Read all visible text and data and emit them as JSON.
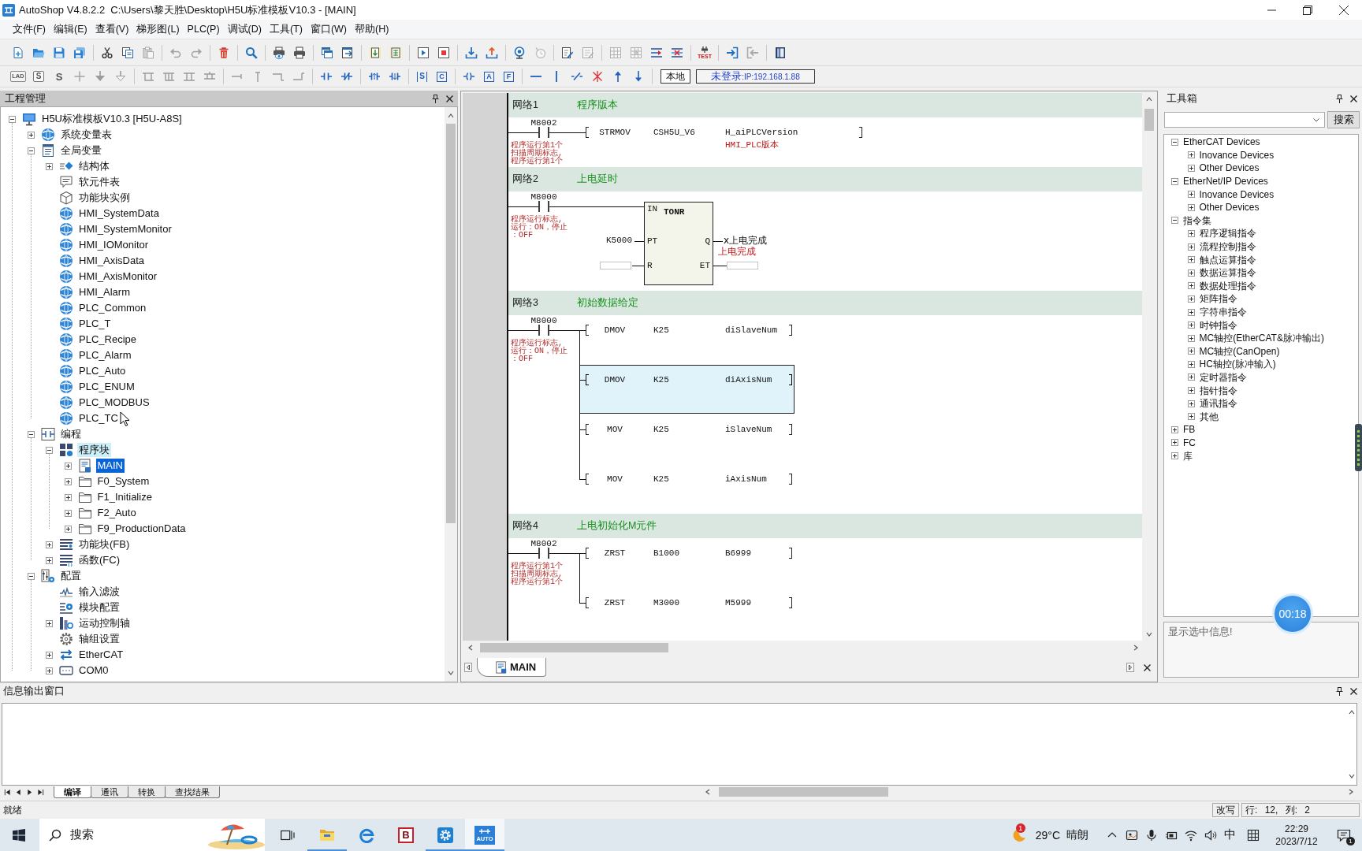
{
  "window": {
    "title": "AutoShop V4.8.2.2  C:\\Users\\黎天胜\\Desktop\\H5U标准模板V10.3 - [MAIN]"
  },
  "menu": [
    "文件(F)",
    "编辑(E)",
    "查看(V)",
    "梯形图(L)",
    "PLC(P)",
    "调试(D)",
    "工具(T)",
    "窗口(W)",
    "帮助(H)"
  ],
  "toolbar_1": [
    [
      {
        "kind": "new",
        "disabled": false
      },
      {
        "kind": "open",
        "disabled": false
      },
      {
        "kind": "save",
        "disabled": false
      },
      {
        "kind": "saveall",
        "disabled": false
      }
    ],
    [
      {
        "kind": "cut",
        "disabled": false
      },
      {
        "kind": "copy",
        "disabled": false
      },
      {
        "kind": "paste",
        "disabled": true
      }
    ],
    [
      {
        "kind": "undo",
        "disabled": true
      },
      {
        "kind": "redo",
        "disabled": true
      }
    ],
    [
      {
        "kind": "delete",
        "disabled": false
      }
    ],
    [
      {
        "kind": "find",
        "disabled": false
      }
    ],
    [
      {
        "kind": "preview",
        "disabled": false
      },
      {
        "kind": "print",
        "disabled": false
      }
    ],
    [
      {
        "kind": "windows",
        "disabled": false
      },
      {
        "kind": "windowarrow",
        "disabled": false
      }
    ],
    [
      {
        "kind": "docdown",
        "disabled": false
      },
      {
        "kind": "docgrid",
        "disabled": false
      }
    ],
    [
      {
        "kind": "run",
        "disabled": false
      },
      {
        "kind": "stop",
        "disabled": false
      }
    ],
    [
      {
        "kind": "download",
        "disabled": false
      },
      {
        "kind": "upload",
        "disabled": false
      }
    ],
    [
      {
        "kind": "monitor",
        "disabled": false
      },
      {
        "kind": "timer",
        "disabled": true
      }
    ],
    [
      {
        "kind": "editcheck",
        "disabled": false
      },
      {
        "kind": "edit",
        "disabled": true
      }
    ],
    [
      {
        "kind": "grid",
        "disabled": true
      },
      {
        "kind": "gridstar",
        "disabled": true
      },
      {
        "kind": "rowins",
        "disabled": false
      },
      {
        "kind": "rowdel",
        "disabled": false
      }
    ],
    [
      {
        "kind": "test",
        "label": "TEST",
        "disabled": false
      }
    ],
    [
      {
        "kind": "login",
        "disabled": false
      },
      {
        "kind": "logout",
        "disabled": true
      }
    ],
    [
      {
        "kind": "book",
        "disabled": false
      }
    ]
  ],
  "toolbar_2": [
    [
      {
        "kind": "lad",
        "label": "LAD",
        "disabled": true
      },
      {
        "kind": "sbox",
        "label": "S",
        "disabled": true
      },
      {
        "kind": "sdollar",
        "label": "S",
        "disabled": true
      },
      {
        "kind": "cross",
        "disabled": true
      },
      {
        "kind": "arrowfill",
        "disabled": true
      },
      {
        "kind": "arrowopen",
        "disabled": true
      }
    ],
    [
      {
        "kind": "branch1",
        "disabled": true
      },
      {
        "kind": "branch2",
        "disabled": true
      },
      {
        "kind": "branch3",
        "disabled": true
      },
      {
        "kind": "branch4",
        "disabled": true
      }
    ],
    [
      {
        "kind": "lineright",
        "disabled": true
      },
      {
        "kind": "lineup",
        "disabled": true
      },
      {
        "kind": "cornerdown",
        "disabled": true
      },
      {
        "kind": "cornerup",
        "disabled": true
      }
    ],
    [
      {
        "kind": "contact",
        "disabled": false
      },
      {
        "kind": "ncontact",
        "disabled": false
      }
    ],
    [
      {
        "kind": "rising",
        "disabled": false
      },
      {
        "kind": "falling",
        "disabled": false
      }
    ],
    [
      {
        "kind": "scontact",
        "label": "S",
        "disabled": false
      },
      {
        "kind": "cblock",
        "label": "C",
        "disabled": false
      }
    ],
    [
      {
        "kind": "coil",
        "disabled": false
      },
      {
        "kind": "ablock",
        "label": "A",
        "disabled": false
      },
      {
        "kind": "fblock",
        "label": "F",
        "disabled": false
      }
    ],
    [
      {
        "kind": "hline",
        "disabled": false
      },
      {
        "kind": "vline",
        "disabled": false
      },
      {
        "kind": "slash",
        "disabled": false
      },
      {
        "kind": "xdel",
        "disabled": false
      },
      {
        "kind": "up",
        "disabled": false
      },
      {
        "kind": "down",
        "disabled": false
      }
    ]
  ],
  "connection": {
    "mode": "本地",
    "status": "未登录",
    "address": ":IP:192.168.1.88"
  },
  "project_tree": {
    "title": "工程管理",
    "items": [
      {
        "label": "H5U标准模板V10.3 [H5U-A8S]",
        "kind": "computer",
        "expanded": true,
        "selected": false,
        "highlighted": false,
        "children": [
          {
            "label": "系统变量表",
            "kind": "globe",
            "expanded": false,
            "selected": false,
            "highlighted": false
          },
          {
            "label": "全局变量",
            "kind": "varlist",
            "expanded": true,
            "selected": false,
            "highlighted": false,
            "children": [
              {
                "label": "结构体",
                "kind": "struct",
                "expanded": false,
                "selected": false,
                "highlighted": false
              },
              {
                "label": "软元件表",
                "kind": "table",
                "selected": false,
                "highlighted": false
              },
              {
                "label": "功能块实例",
                "kind": "cube",
                "selected": false,
                "highlighted": false
              },
              {
                "label": "HMI_SystemData",
                "kind": "globe",
                "selected": false,
                "highlighted": false
              },
              {
                "label": "HMI_SystemMonitor",
                "kind": "globe",
                "selected": false,
                "highlighted": false
              },
              {
                "label": "HMI_IOMonitor",
                "kind": "globe",
                "selected": false,
                "highlighted": false
              },
              {
                "label": "HMI_AxisData",
                "kind": "globe",
                "selected": false,
                "highlighted": false
              },
              {
                "label": "HMI_AxisMonitor",
                "kind": "globe",
                "selected": false,
                "highlighted": false
              },
              {
                "label": "HMI_Alarm",
                "kind": "globe",
                "selected": false,
                "highlighted": false
              },
              {
                "label": "PLC_Common",
                "kind": "globe",
                "selected": false,
                "highlighted": false
              },
              {
                "label": "PLC_T",
                "kind": "globe",
                "selected": false,
                "highlighted": false
              },
              {
                "label": "PLC_Recipe",
                "kind": "globe",
                "selected": false,
                "highlighted": false
              },
              {
                "label": "PLC_Alarm",
                "kind": "globe",
                "selected": false,
                "highlighted": false
              },
              {
                "label": "PLC_Auto",
                "kind": "globe",
                "selected": false,
                "highlighted": false
              },
              {
                "label": "PLC_ENUM",
                "kind": "globe",
                "selected": false,
                "highlighted": false
              },
              {
                "label": "PLC_MODBUS",
                "kind": "globe",
                "selected": false,
                "highlighted": false
              },
              {
                "label": "PLC_TC",
                "kind": "globe",
                "selected": false,
                "highlighted": false
              }
            ]
          },
          {
            "label": "编程",
            "kind": "ladder",
            "expanded": true,
            "selected": false,
            "highlighted": false,
            "children": [
              {
                "label": "程序块",
                "kind": "blocks",
                "expanded": true,
                "selected": false,
                "highlighted": true,
                "children": [
                  {
                    "label": "MAIN",
                    "kind": "program",
                    "expanded": false,
                    "selected": true,
                    "highlighted": false
                  },
                  {
                    "label": "F0_System",
                    "kind": "folder",
                    "expanded": false,
                    "selected": false,
                    "highlighted": false
                  },
                  {
                    "label": "F1_Initialize",
                    "kind": "folder",
                    "expanded": false,
                    "selected": false,
                    "highlighted": false
                  },
                  {
                    "label": "F2_Auto",
                    "kind": "folder",
                    "expanded": false,
                    "selected": false,
                    "highlighted": false
                  },
                  {
                    "label": "F9_ProductionData",
                    "kind": "folder",
                    "expanded": false,
                    "selected": false,
                    "highlighted": false
                  }
                ]
              },
              {
                "label": "功能块(FB)",
                "kind": "fblist",
                "expanded": false,
                "selected": false,
                "highlighted": false
              },
              {
                "label": "函数(FC)",
                "kind": "fclist",
                "expanded": false,
                "selected": false,
                "highlighted": false
              }
            ]
          },
          {
            "label": "配置",
            "kind": "config",
            "expanded": true,
            "selected": false,
            "highlighted": false,
            "children": [
              {
                "label": "输入滤波",
                "kind": "filter",
                "selected": false,
                "highlighted": false
              },
              {
                "label": "模块配置",
                "kind": "module",
                "selected": false,
                "highlighted": false
              },
              {
                "label": "运动控制轴",
                "kind": "axis",
                "expanded": false,
                "selected": false,
                "highlighted": false
              },
              {
                "label": "轴组设置",
                "kind": "gear",
                "selected": false,
                "highlighted": false
              },
              {
                "label": "EtherCAT",
                "kind": "ethercat",
                "expanded": false,
                "selected": false,
                "highlighted": false
              },
              {
                "label": "COM0",
                "kind": "com",
                "expanded": false,
                "selected": false,
                "highlighted": false
              }
            ]
          }
        ]
      }
    ]
  },
  "editor": {
    "networks": [
      {
        "label": "网络1",
        "comment": "程序版本",
        "contact": {
          "address": "M8002",
          "comment": "程序运行第1个扫描周期标志,程序运行第1个"
        },
        "instructions": [
          {
            "op": "STRMOV",
            "operands": [
              "CSH5U_V6",
              "H_aiPLCVersion"
            ],
            "note": "HMI_PLC版本",
            "selected": false
          }
        ]
      },
      {
        "label": "网络2",
        "comment": "上电延时",
        "contact": {
          "address": "M8000",
          "comment": "程序运行标志,运行：ON，停止：OFF"
        },
        "block": {
          "name": "TONR",
          "inputs": [
            {
              "pin": "IN",
              "kind": "wire"
            },
            {
              "pin": "PT",
              "kind": "value",
              "value": "K5000"
            },
            {
              "pin": "R",
              "kind": "field"
            }
          ],
          "outputs": [
            {
              "pin": "Q",
              "kind": "value",
              "value": "x上电完成",
              "note": "上电完成"
            },
            {
              "pin": "ET",
              "kind": "field"
            }
          ]
        }
      },
      {
        "label": "网络3",
        "comment": "初始数据给定",
        "contact": {
          "address": "M8000",
          "comment": "程序运行标志,运行：ON，停止：OFF"
        },
        "instructions": [
          {
            "op": "DMOV",
            "operands": [
              "K25",
              "diSlaveNum"
            ],
            "selected": false
          },
          {
            "op": "DMOV",
            "operands": [
              "K25",
              "diAxisNum"
            ],
            "selected": true
          },
          {
            "op": "MOV",
            "operands": [
              "K25",
              "iSlaveNum"
            ],
            "selected": false
          },
          {
            "op": "MOV",
            "operands": [
              "K25",
              "iAxisNum"
            ],
            "selected": false
          }
        ]
      },
      {
        "label": "网络4",
        "comment": "上电初始化M元件",
        "contact": {
          "address": "M8002",
          "comment": "程序运行第1个扫描周期标志,程序运行第1个"
        },
        "instructions": [
          {
            "op": "ZRST",
            "operands": [
              "B1000",
              "B6999"
            ],
            "selected": false
          },
          {
            "op": "ZRST",
            "operands": [
              "M3000",
              "M5999"
            ],
            "selected": false
          }
        ]
      }
    ],
    "tabs": [
      {
        "label": "MAIN",
        "selected": true
      }
    ]
  },
  "toolbox": {
    "title": "工具箱",
    "search_button": "搜索",
    "items": [
      {
        "label": "EtherCAT Devices",
        "expanded": true,
        "selected": false,
        "children": [
          {
            "label": "Inovance Devices",
            "expanded": false,
            "selected": false
          },
          {
            "label": "Other Devices",
            "expanded": false,
            "selected": false
          }
        ]
      },
      {
        "label": "EtherNet/IP Devices",
        "expanded": true,
        "selected": false,
        "children": [
          {
            "label": "Inovance Devices",
            "expanded": false,
            "selected": false
          },
          {
            "label": "Other Devices",
            "expanded": false,
            "selected": false
          }
        ]
      },
      {
        "label": "指令集",
        "expanded": true,
        "selected": false,
        "children": [
          {
            "label": "程序逻辑指令",
            "expanded": false,
            "selected": false
          },
          {
            "label": "流程控制指令",
            "expanded": false,
            "selected": false
          },
          {
            "label": "触点运算指令",
            "expanded": false,
            "selected": false
          },
          {
            "label": "数据运算指令",
            "expanded": false,
            "selected": false
          },
          {
            "label": "数据处理指令",
            "expanded": false,
            "selected": false
          },
          {
            "label": "矩阵指令",
            "expanded": false,
            "selected": false
          },
          {
            "label": "字符串指令",
            "expanded": false,
            "selected": false
          },
          {
            "label": "时钟指令",
            "expanded": false,
            "selected": false
          },
          {
            "label": "MC轴控(EtherCAT&脉冲输出)",
            "expanded": false,
            "selected": false
          },
          {
            "label": "MC轴控(CanOpen)",
            "expanded": false,
            "selected": false
          },
          {
            "label": "HC轴控(脉冲输入)",
            "expanded": false,
            "selected": false
          },
          {
            "label": "定时器指令",
            "expanded": false,
            "selected": false
          },
          {
            "label": "指针指令",
            "expanded": false,
            "selected": false
          },
          {
            "label": "通讯指令",
            "expanded": false,
            "selected": false
          },
          {
            "label": "其他",
            "expanded": false,
            "selected": false
          }
        ]
      },
      {
        "label": "FB",
        "expanded": false,
        "selected": false
      },
      {
        "label": "FC",
        "expanded": false,
        "selected": false
      },
      {
        "label": "库",
        "expanded": false,
        "selected": false
      }
    ],
    "info": "显示选中信息!"
  },
  "output": {
    "title": "信息输出窗口",
    "tabs": [
      {
        "label": "编译",
        "selected": true
      },
      {
        "label": "通讯",
        "selected": false
      },
      {
        "label": "转换",
        "selected": false
      },
      {
        "label": "查找结果",
        "selected": false
      }
    ]
  },
  "status_bar": {
    "text": "就绪",
    "mode": "改写",
    "position": "行: 12, 列: 2"
  },
  "taskbar": {
    "search": {
      "placeholder": "搜索"
    },
    "apps": [
      {
        "kind": "explorer",
        "running": true,
        "selected": false
      },
      {
        "kind": "edge",
        "running": false,
        "selected": false
      },
      {
        "kind": "bapp",
        "label": "B",
        "running": false,
        "selected": false
      },
      {
        "kind": "gear",
        "running": true,
        "selected": false
      },
      {
        "kind": "autoshop",
        "label": "AUTO",
        "running": true,
        "selected": true
      }
    ],
    "weather": {
      "badge": "1",
      "temperature": "29°C",
      "condition": "晴朗"
    },
    "ime": "中",
    "clock": {
      "time": "22:29",
      "date": "2023/7/12"
    },
    "notification_count": "1"
  },
  "recorder": {
    "time": "00:18"
  }
}
